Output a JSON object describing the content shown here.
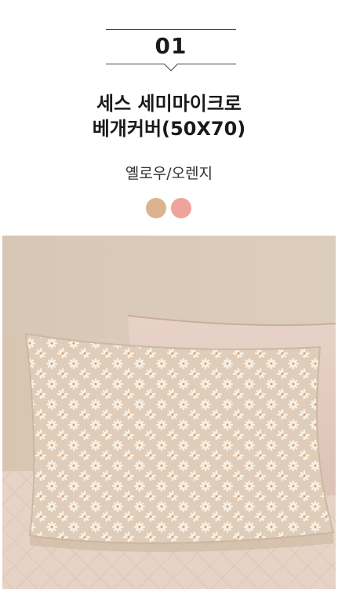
{
  "badge": {
    "number": "01"
  },
  "product": {
    "title_line1": "세스 세미마이크로",
    "title_line2": "베개커버(50X70)",
    "color_name": "옐로우/오렌지"
  },
  "swatches": [
    {
      "name": "yellow",
      "color": "#d9b48e"
    },
    {
      "name": "orange",
      "color": "#eea49a"
    }
  ],
  "photo": {
    "subject": "floral pillowcase on bed"
  }
}
